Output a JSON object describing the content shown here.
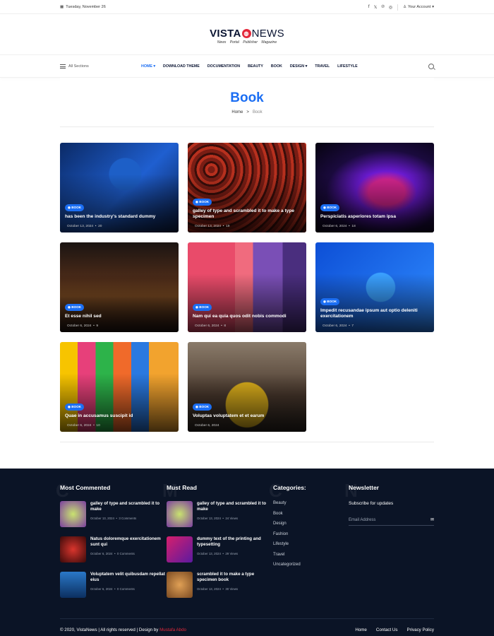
{
  "topbar": {
    "date": "Tuesday, November 26",
    "account": "Your Account"
  },
  "social_icons": [
    "facebook-icon",
    "x-icon",
    "pinterest-icon",
    "instagram-icon"
  ],
  "logo": {
    "part1": "VISTA",
    "part2": "NEWS",
    "tagline": "News Portal  Publisher  Magazine"
  },
  "nav": {
    "sections": "All Sections",
    "items": [
      "HOME",
      "DOWNLOAD THEME",
      "DOCUMENTATION",
      "BEAUTY",
      "BOOK",
      "DESIGN",
      "TRAVEL",
      "LIFESTYLE"
    ]
  },
  "page": {
    "title": "Book",
    "crumb_home": "Home",
    "crumb_sep": ">",
    "crumb_current": "Book"
  },
  "posts": [
    {
      "badge": "BOOK",
      "title": "has been the industry's standard dummy",
      "date": "October 13, 2024",
      "comments": "20"
    },
    {
      "badge": "BOOK",
      "title": "galley of type and scrambled it to make a type specimen",
      "date": "October 13, 2024",
      "comments": "19"
    },
    {
      "badge": "BOOK",
      "title": "Perspiciatis asperiores totam ipsa",
      "date": "October 6, 2024",
      "comments": "18"
    },
    {
      "badge": "BOOK",
      "title": "Et esse nihil sed",
      "date": "October 6, 2024",
      "comments": "9"
    },
    {
      "badge": "BOOK",
      "title": "Nam qui ea quia quos odit nobis commodi",
      "date": "October 6, 2024",
      "comments": "8"
    },
    {
      "badge": "BOOK",
      "title": "Impedit recusandae ipsum aut optio deleniti exercitationem",
      "date": "October 6, 2024",
      "comments": "7"
    },
    {
      "badge": "BOOK",
      "title": "Quae in accusamus suscipit id",
      "date": "October 6, 2024",
      "comments": "10"
    },
    {
      "badge": "BOOK",
      "title": "Voluptas voluptatem et et earum",
      "date": "October 6, 2024",
      "comments": ""
    }
  ],
  "footer": {
    "most_commented": {
      "title": "Most Commented",
      "ghost": "C",
      "items": [
        {
          "title": "galley of type and scrambled it to make",
          "date": "October 13, 2024",
          "meta": "3 Comments"
        },
        {
          "title": "Natus doloremque exercitationem sunt qui",
          "date": "October 6, 2024",
          "meta": "0 Comments"
        },
        {
          "title": "Voluptatem velit quibusdam repellat eius",
          "date": "October 6, 2024",
          "meta": "0 Comments"
        }
      ]
    },
    "must_read": {
      "title": "Must Read",
      "ghost": "M",
      "items": [
        {
          "title": "galley of type and scrambled it to make",
          "date": "October 13, 2024",
          "meta": "24 Views"
        },
        {
          "title": "dummy text of the printing and typesetting",
          "date": "October 13, 2024",
          "meta": "29 Views"
        },
        {
          "title": "scrambled it to make a type specimen book",
          "date": "October 13, 2024",
          "meta": "30 Views"
        }
      ]
    },
    "categories": {
      "title": "Categories:",
      "ghost": "C",
      "items": [
        "Beauty",
        "Book",
        "Design",
        "Fashion",
        "Lifestyle",
        "Travel",
        "Uncategorized"
      ]
    },
    "newsletter": {
      "title": "Newsletter",
      "ghost": "N",
      "subtitle": "Subscribe for updates",
      "placeholder": "Email Address"
    },
    "copyright": "© 2020, VistaNews | All rights reserved | Design by",
    "designer": "Mustafa Abdo",
    "links": [
      "Home",
      "Contact Us",
      "Privacy Policy"
    ]
  },
  "colors": {
    "accent": "#1b6ef3",
    "brand_red": "#e4283b",
    "footer_bg": "#0b1426"
  }
}
